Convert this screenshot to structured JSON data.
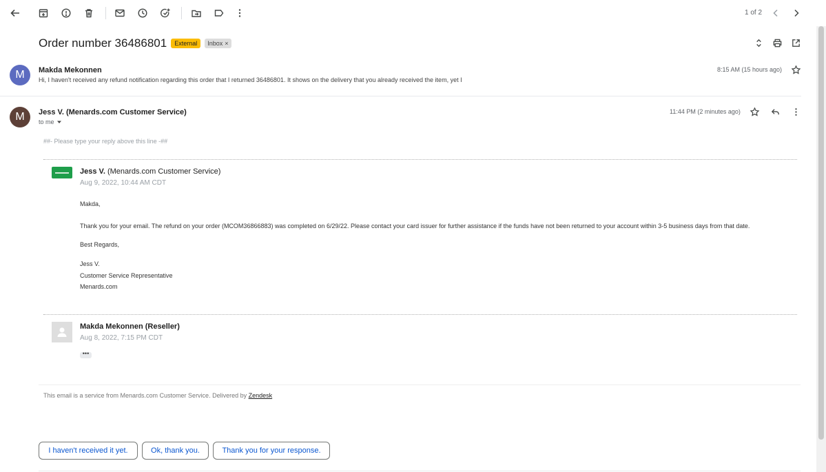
{
  "toolbar": {
    "pager": "1 of 2"
  },
  "subject": {
    "title": "Order number 36486801",
    "labels": {
      "external": "External",
      "inbox": "Inbox",
      "inbox_remove": "×"
    }
  },
  "messages": [
    {
      "avatar_letter": "M",
      "avatar_color": "#5c6bc0",
      "sender": "Makda Mekonnen",
      "snippet": "Hi, I haven't received any refund notification regarding this order that I returned 36486801. It shows on the delivery that you already received the item, yet I",
      "time": "8:15 AM (15 hours ago)"
    },
    {
      "avatar_letter": "M",
      "avatar_color": "#5d4037",
      "sender": "Jess V. (Menards.com Customer Service)",
      "to": "to me",
      "time": "11:44 PM (2 minutes ago)"
    }
  ],
  "body": {
    "reply_hint": "##- Please type your reply above this line -##",
    "comments": [
      {
        "name_bold": "Jess V.",
        "name_rest": "(Menards.com Customer Service)",
        "date": "Aug 9, 2022, 10:44 AM CDT",
        "lines": [
          "Makda,",
          "Thank you for your email. The refund on your order (MCOM36866883) was completed on 6/29/22. Please contact your card issuer for further assistance if the funds have not been returned to your account within 3-5 business days from that date.",
          "Best Regards,",
          "Jess V.",
          "Customer Service Representative",
          "Menards.com"
        ]
      },
      {
        "name_bold": "Makda Mekonnen (Reseller)",
        "date": "Aug 8, 2022, 7:15 PM CDT",
        "ellipsis": "•••"
      }
    ],
    "footer_prefix": "This email is a service from Menards.com Customer Service. Delivered by",
    "footer_link": "Zendesk"
  },
  "smart_replies": [
    "I haven't received it yet.",
    "Ok, thank you.",
    "Thank you for your response."
  ]
}
